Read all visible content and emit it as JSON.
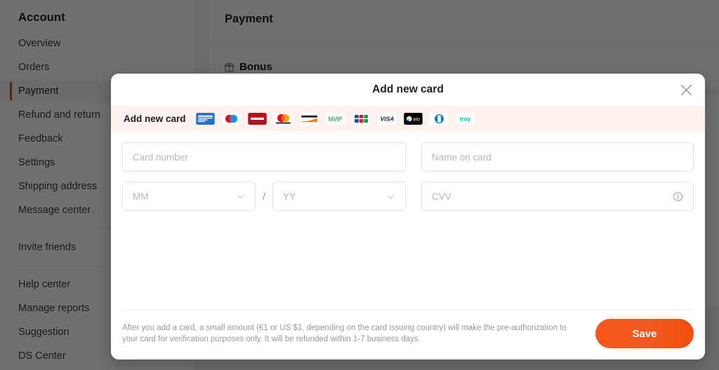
{
  "sidebar": {
    "title": "Account",
    "groups": [
      {
        "items": [
          {
            "label": "Overview",
            "active": false
          },
          {
            "label": "Orders",
            "active": false
          },
          {
            "label": "Payment",
            "active": true
          },
          {
            "label": "Refund and return",
            "active": false
          },
          {
            "label": "Feedback",
            "active": false
          },
          {
            "label": "Settings",
            "active": false
          },
          {
            "label": "Shipping address",
            "active": false
          },
          {
            "label": "Message center",
            "active": false
          }
        ]
      },
      {
        "items": [
          {
            "label": "Invite friends",
            "active": false
          }
        ]
      },
      {
        "items": [
          {
            "label": "Help center",
            "active": false
          },
          {
            "label": "Manage reports",
            "active": false
          },
          {
            "label": "Suggestion",
            "active": false
          },
          {
            "label": "DS Center",
            "active": false
          }
        ]
      }
    ]
  },
  "content": {
    "page_title": "Payment",
    "bonus_label": "Bonus",
    "bonus_icon": "bonus-gift-icon"
  },
  "modal": {
    "title": "Add new card",
    "close_icon": "close-icon",
    "brands_label": "Add new card",
    "brands": [
      {
        "name": "american-express",
        "label": "AMERICAN EXPRESS"
      },
      {
        "name": "maestro",
        "label": "Maestro"
      },
      {
        "name": "hipercard",
        "label": "Hipercard"
      },
      {
        "name": "mastercard",
        "label": "mastercard"
      },
      {
        "name": "discover",
        "label": "DISCOVER"
      },
      {
        "name": "mir",
        "label": "МИР"
      },
      {
        "name": "jcb",
        "label": "JCB"
      },
      {
        "name": "visa",
        "label": "VISA"
      },
      {
        "name": "elo",
        "label": "elo"
      },
      {
        "name": "diners-club",
        "label": "Diners Club"
      },
      {
        "name": "troy",
        "label": "troy"
      }
    ],
    "fields": {
      "card_number": {
        "placeholder": "Card number",
        "value": ""
      },
      "name_on_card": {
        "placeholder": "Name on card",
        "value": ""
      },
      "expiry_month": {
        "placeholder": "MM",
        "value": ""
      },
      "expiry_separator": "/",
      "expiry_year": {
        "placeholder": "YY",
        "value": ""
      },
      "cvv": {
        "placeholder": "CVV",
        "value": "",
        "info_icon": "info-circle-icon"
      }
    },
    "footer_note": "After you add a card, a small amount (€1 or US $1, depending on the card issuing country) will make the pre-authorization to your card for verification purposes only. It will be refunded within 1-7 business days.",
    "save_label": "Save"
  },
  "colors": {
    "accent": "#f2530f",
    "active_bar": "#c94829",
    "brands_strip_bg": "#fdf2ee",
    "overlay": "rgba(0,0,0,0.56)"
  }
}
